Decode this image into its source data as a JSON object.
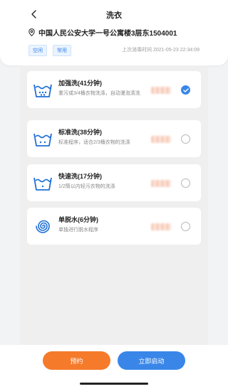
{
  "header": {
    "title": "洗衣",
    "location": "中国人民公安大学一号公寓楼3层东1504001",
    "tags": [
      "空闲",
      "常用"
    ],
    "last_disinfect": "上次消毒时间 2021-05-23 22:34:09"
  },
  "programs": [
    {
      "title": "加强洗(41分钟)",
      "desc": "重污或3/4桶衣物洗涤，自动漫泡清洗",
      "icon": "wash-heavy-icon",
      "selected": true
    },
    {
      "title": "标准洗(38分钟)",
      "desc": "标准程序，适合2/3桶衣物的洗涤",
      "icon": "wash-standard-icon",
      "selected": false
    },
    {
      "title": "快速洗(17分钟)",
      "desc": "1/2筒以内轻污衣物的洗涤",
      "icon": "wash-quick-icon",
      "selected": false
    },
    {
      "title": "单脱水(6分钟)",
      "desc": "单独进行脱水程序",
      "icon": "spin-dry-icon",
      "selected": false
    }
  ],
  "actions": {
    "reserve_label": "预约",
    "start_label": "立即启动"
  },
  "colors": {
    "accent": "#3a86e8",
    "reserve": "#f57a2a"
  }
}
